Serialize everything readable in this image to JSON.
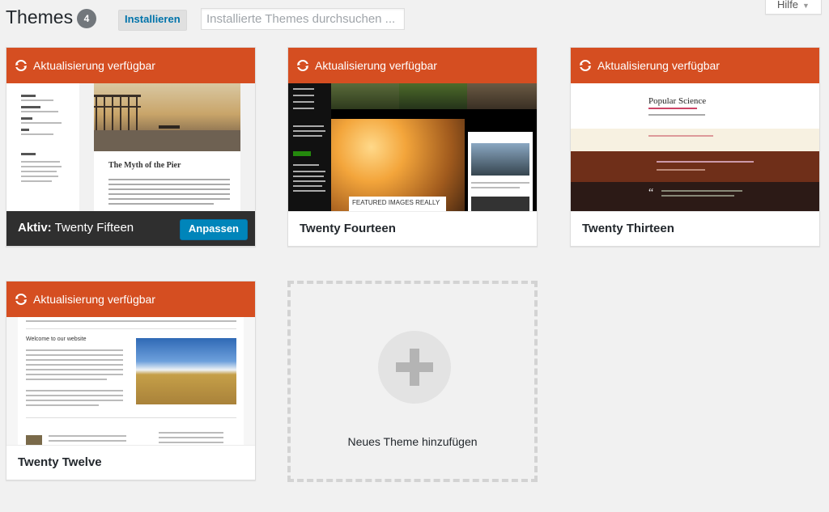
{
  "header": {
    "title": "Themes",
    "count": "4",
    "install_label": "Installieren",
    "search_placeholder": "Installierte Themes durchsuchen ...",
    "help_label": "Hilfe"
  },
  "update_notice": "Aktualisierung verfügbar",
  "themes": [
    {
      "name": "Twenty Fifteen",
      "active_prefix": "Aktiv:",
      "customize_label": "Anpassen",
      "preview_post_title": "The Myth of the Pier"
    },
    {
      "name": "Twenty Fourteen",
      "preview_caption": "FEATURED IMAGES REALLY"
    },
    {
      "name": "Twenty Thirteen",
      "preview_title": "Popular Science"
    },
    {
      "name": "Twenty Twelve",
      "preview_heading": "Welcome to our website"
    }
  ],
  "add_new": {
    "label": "Neues Theme hinzufügen"
  },
  "colors": {
    "notice": "#d54e21",
    "primary_button": "#0085ba",
    "active_bar": "#2f2f2f"
  }
}
